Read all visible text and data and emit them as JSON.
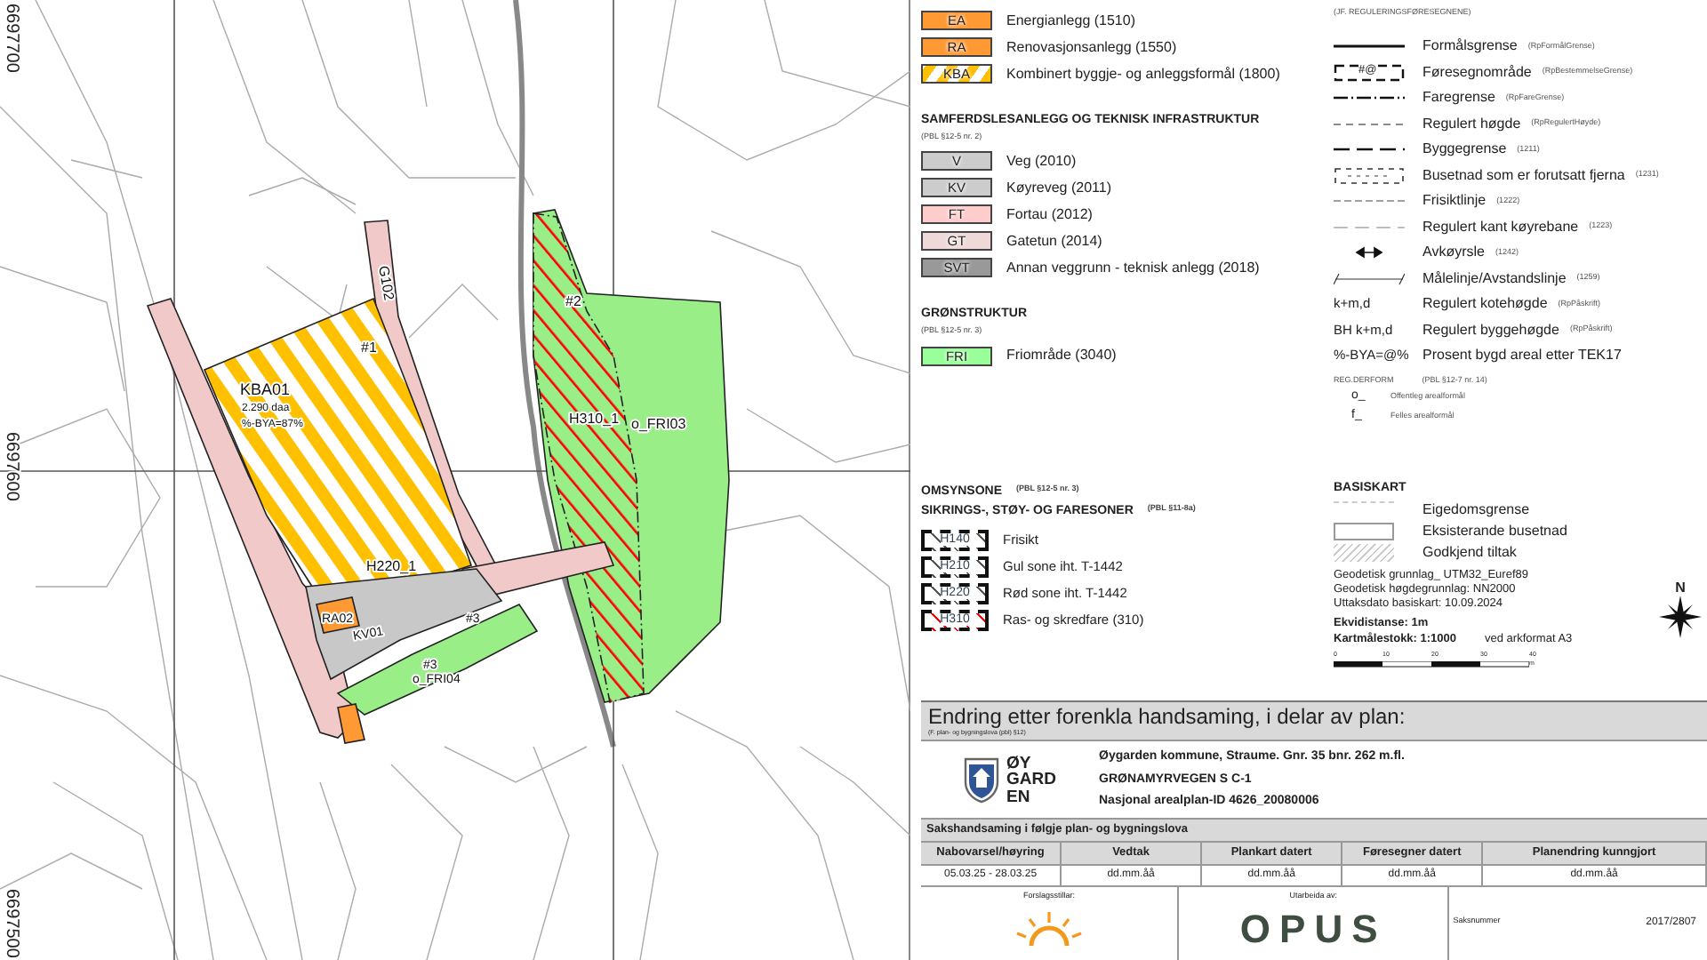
{
  "map": {
    "grid_labels": [
      "6697700",
      "6697600",
      "6697500"
    ],
    "labels": [
      "KBA01",
      "2.290 daa",
      "%-BYA=87%",
      "#1",
      "G102",
      "H220_1",
      "RA02",
      "KV01",
      "#3",
      "#3",
      "o_FRI04",
      "#2",
      "H310_1",
      "o_FRI03"
    ]
  },
  "landuse_legend": {
    "sections": [
      {
        "items": [
          {
            "code": "EA",
            "label": "Energianlegg (1510)",
            "color": "#ff9933",
            "kind": "solid"
          },
          {
            "code": "RA",
            "label": "Renovasjonsanlegg (1550)",
            "color": "#ff9933",
            "kind": "solid"
          },
          {
            "code": "KBA",
            "label": "Kombinert byggje- og anleggsformål (1800)",
            "color": "#ffc000",
            "kind": "stripe"
          }
        ]
      },
      {
        "title": "SAMFERDSLESANLEGG OG TEKNISK INFRASTRUKTUR",
        "note": "(PBL §12-5 nr. 2)",
        "items": [
          {
            "code": "V",
            "label": "Veg (2010)",
            "color": "#cccccc",
            "kind": "solid"
          },
          {
            "code": "KV",
            "label": "Køyreveg (2011)",
            "color": "#cccccc",
            "kind": "solid"
          },
          {
            "code": "FT",
            "label": "Fortau (2012)",
            "color": "#ffcccc",
            "kind": "solid"
          },
          {
            "code": "GT",
            "label": "Gatetun (2014)",
            "color": "#eed8d8",
            "kind": "solid"
          },
          {
            "code": "SVT",
            "label": "Annan veggrunn - teknisk anlegg (2018)",
            "color": "#999999",
            "kind": "solid"
          }
        ]
      },
      {
        "title": "GRØNSTRUKTUR",
        "note": "(PBL §12-5 nr. 3)",
        "items": [
          {
            "code": "FRI",
            "label": "Friområde (3040)",
            "color": "#99ff99",
            "kind": "solid"
          }
        ]
      }
    ]
  },
  "line_legend": {
    "note": "(JF. REGULERINGSFØRESEGNENE)",
    "items": [
      {
        "kind": "solid",
        "label": "Formålsgrense",
        "note": "(RpFormålGrense)"
      },
      {
        "kind": "box",
        "symbol": "#@",
        "label": "Føresegnområde",
        "note": "(RpBestemmelseGrense)"
      },
      {
        "kind": "dashdot",
        "label": "Faregrense",
        "note": "(RpFareGrense)"
      },
      {
        "kind": "dashed",
        "label": "Regulert høgde",
        "note": "(RpRegulertHøyde)"
      },
      {
        "kind": "longdash",
        "label": "Byggegrense",
        "note": "(1211)"
      },
      {
        "kind": "dashbox",
        "label": "Busetnad som er forutsatt fjerna",
        "note": "(1231)"
      },
      {
        "kind": "thindash",
        "label": "Frisiktlinje",
        "note": "(1222)"
      },
      {
        "kind": "lightdash",
        "label": "Regulert kant køyrebane",
        "note": "(1223)"
      },
      {
        "kind": "arrows",
        "label": "Avkøyrsle",
        "note": "(1242)"
      },
      {
        "kind": "measure",
        "label": "Målelinje/Avstandslinje",
        "note": "(1259)"
      },
      {
        "kind": "text",
        "symbol": "k+m,d",
        "label": "Regulert kotehøgde",
        "note": "(RpPåskrift)"
      },
      {
        "kind": "text",
        "symbol": "BH k+m,d",
        "label": "Regulert byggehøgde",
        "note": "(RpPåskrift)"
      },
      {
        "kind": "text",
        "symbol": "%-BYA=@%",
        "label": "Prosent bygd areal etter TEK17"
      }
    ],
    "ownership": {
      "title": "REG.DERFORM",
      "note": "(PBL §12-7 nr. 14)",
      "items": [
        {
          "symbol": "o_",
          "label": "Offentleg arealformål"
        },
        {
          "symbol": "f_",
          "label": "Felles arealformål"
        }
      ]
    }
  },
  "zones": {
    "title": "OMSYNSONE",
    "title_note": "(PBL §12-5 nr. 3)",
    "subtitle": "SIKRINGS-, STØY- OG FARESONER",
    "subtitle_note": "(PBL §11-8a)",
    "items": [
      {
        "code": "H140",
        "label": "Frisikt",
        "kind": "black"
      },
      {
        "code": "H210",
        "label": "Gul sone iht. T-1442",
        "kind": "black"
      },
      {
        "code": "H220",
        "label": "Rød sone iht. T-1442",
        "kind": "black"
      },
      {
        "code": "H310",
        "label": "Ras- og skredfare (310)",
        "kind": "red"
      }
    ]
  },
  "base_map": {
    "title": "BASISKART",
    "items": [
      {
        "kind": "line",
        "label": "Eigedomsgrense"
      },
      {
        "kind": "outline",
        "label": "Eksisterande busetnad"
      },
      {
        "kind": "hatch",
        "label": "Godkjend tiltak"
      }
    ],
    "info": [
      "Geodetisk grunnlag_ UTM32_Euref89",
      "Geodetisk høgdegrunnlag: NN2000",
      "Uttaksdato basiskart: 10.09.2024"
    ],
    "contour_interval": "Ekvidistanse: 1m",
    "scale": "Kartmålestokk: 1:1000",
    "sheet": "ved arkformat A3",
    "scale_ticks": [
      "0",
      "10",
      "20",
      "30",
      "40 m"
    ],
    "north": "N"
  },
  "title_block": {
    "heading": "Endring etter forenkla handsaming, i delar av plan:",
    "heading_note": "(F. plan- og bygningslova (pbl) §12)",
    "logo_text": [
      "ØY",
      "GARD",
      "EN"
    ],
    "plan_lines": [
      "Øygarden kommune, Straume. Gnr. 35 bnr. 262 m.fl.",
      "GRØNAMYRVEGEN S C-1",
      "Nasjonal arealplan-ID 4626_20080006"
    ],
    "process_title": "Sakshandsaming i følgje plan- og bygningslova",
    "columns": [
      "Nabovarsel/høyring",
      "Vedtak",
      "Plankart datert",
      "Føresegner datert",
      "Planendring kunngjort"
    ],
    "values": [
      "05.03.25 - 28.03.25",
      "dd.mm.åå",
      "dd.mm.åå",
      "dd.mm.åå",
      "dd.mm.åå"
    ],
    "proposer_label": "Forslagsstillar:",
    "author_label": "Utarbeida av:",
    "author_logo": "OPUS",
    "case_label": "Saksnummer",
    "case_number": "2017/2807"
  }
}
